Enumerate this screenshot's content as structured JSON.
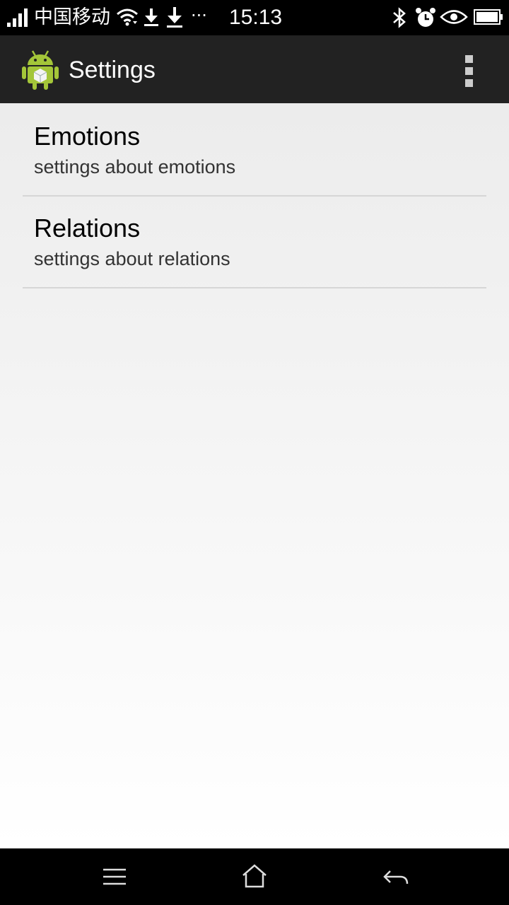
{
  "status_bar": {
    "carrier": "中国移动",
    "more": "···",
    "time": "15:13"
  },
  "action_bar": {
    "title": "Settings",
    "app_icon": "android-robot-icon",
    "overflow_icon": "overflow-menu-icon"
  },
  "preferences": [
    {
      "title": "Emotions",
      "summary": "settings about emotions"
    },
    {
      "title": "Relations",
      "summary": "settings about relations"
    }
  ],
  "nav_bar": {
    "menu_icon": "menu-icon",
    "home_icon": "home-icon",
    "back_icon": "back-icon"
  },
  "colors": {
    "action_bar_bg": "#222222",
    "android_green": "#a4c639",
    "status_bar_bg": "#000000"
  }
}
